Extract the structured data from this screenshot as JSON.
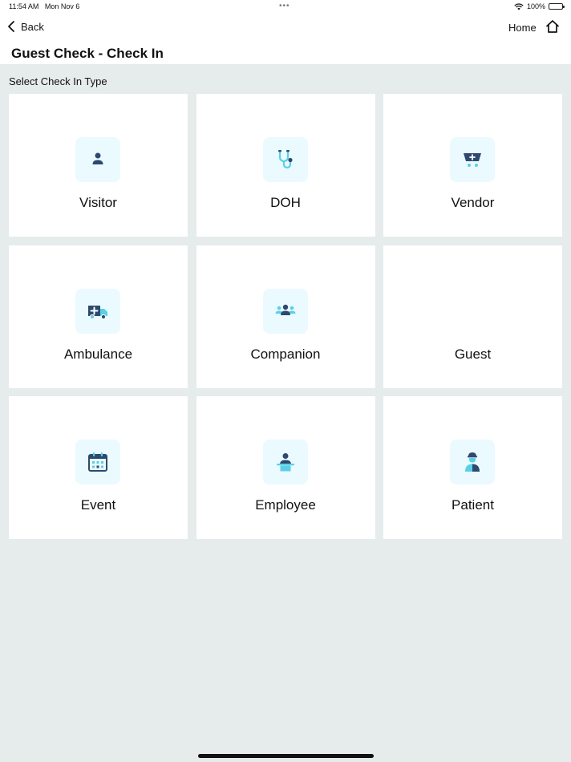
{
  "status_bar": {
    "time": "11:54 AM",
    "date": "Mon Nov 6",
    "dots": "•••",
    "battery_percent": "100%",
    "battery_level": 1.0
  },
  "nav": {
    "back_label": "Back",
    "home_label": "Home",
    "title": "Guest Check - Check In"
  },
  "section_label": "Select Check In Type",
  "tiles": [
    {
      "label": "Visitor",
      "icon": "person-icon"
    },
    {
      "label": "DOH",
      "icon": "stethoscope-icon"
    },
    {
      "label": "Vendor",
      "icon": "cart-plus-icon"
    },
    {
      "label": "Ambulance",
      "icon": "ambulance-icon"
    },
    {
      "label": "Companion",
      "icon": "group-icon"
    },
    {
      "label": "Guest",
      "icon": ""
    },
    {
      "label": "Event",
      "icon": "calendar-icon"
    },
    {
      "label": "Employee",
      "icon": "employee-icon"
    },
    {
      "label": "Patient",
      "icon": "patient-icon"
    }
  ],
  "colors": {
    "background": "#e6ebeb",
    "tile_background": "#ffffff",
    "icon_tile_background": "#ebfaff",
    "icon_dark": "#2d4a6e",
    "icon_accent": "#5ad0e6"
  }
}
